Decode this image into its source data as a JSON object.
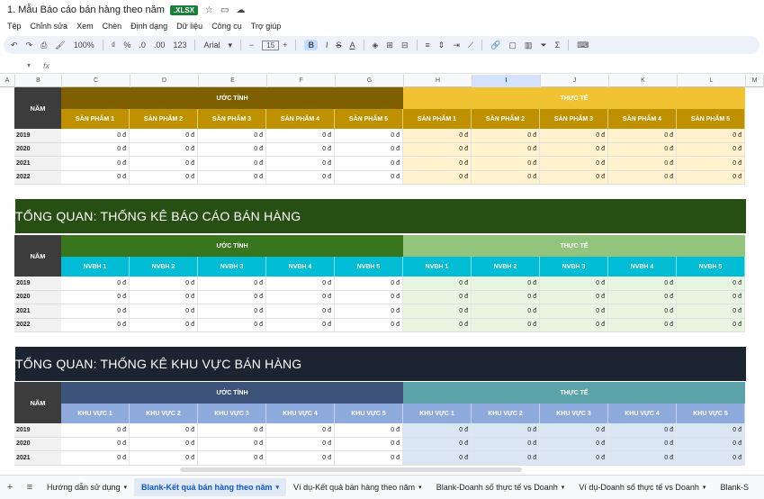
{
  "doc": {
    "title": "1. Mẫu Báo cáo bán hàng theo năm",
    "badge": ".XLSX"
  },
  "menu": [
    "Tệp",
    "Chỉnh sửa",
    "Xem",
    "Chèn",
    "Định dạng",
    "Dữ liệu",
    "Công cụ",
    "Trợ giúp"
  ],
  "toolbar": {
    "zoom": "100%",
    "font": "Arial",
    "font_size": "15",
    "num_format": "123",
    "percent": "%",
    "currency": "₫",
    "bold": "B",
    "italic": "I",
    "strike": "S",
    "text_color": "A",
    "dec_less": ".0",
    "dec_more": ".00",
    "minus": "−",
    "plus": "+"
  },
  "formula": {
    "fx": "fx",
    "namebox": "▾"
  },
  "columns": [
    "A",
    "B",
    "C",
    "D",
    "E",
    "F",
    "G",
    "H",
    "I",
    "J",
    "K",
    "L",
    "M"
  ],
  "selected_column": "I",
  "colors": {
    "estimate1": "#7f6000",
    "actual1": "#f1c232",
    "sub1": "#bf9000",
    "est_row": "#ffffff",
    "act_row": "#fff2cc",
    "nam": "#3c3c3c",
    "banner2": "#274e13",
    "estimate2": "#38761d",
    "actual2": "#93c47d",
    "sub2": "#00bcd4",
    "act_row2": "#e6f4e0",
    "banner3": "#1c2331",
    "estimate3": "#3d5278",
    "actual3": "#5ca3a9",
    "sub3": "#8ea9db",
    "act_row3": "#dbe6f5"
  },
  "table1": {
    "nam": "NĂM",
    "estimate": "ƯỚC TÍNH",
    "actual": "THỰC TẾ",
    "sub": [
      "SẢN PHẨM 1",
      "SẢN PHẨM 2",
      "SẢN PHẨM 3",
      "SẢN PHẨM 4",
      "SẢN PHẨM 5",
      "SẢN PHẨM 1",
      "SẢN PHẨM 2",
      "SẢN PHẨM 3",
      "SẢN PHẨM 4",
      "SẢN PHẨM 5"
    ],
    "years": [
      "2019",
      "2020",
      "2021",
      "2022"
    ]
  },
  "banner2": "TỔNG QUAN: THỐNG KÊ BÁO CÁO BÁN HÀNG",
  "table2": {
    "nam": "NĂM",
    "estimate": "ƯỚC TÍNH",
    "actual": "THỰC TẾ",
    "sub": [
      "NVBH 1",
      "NVBH 2",
      "NVBH 3",
      "NVBH 4",
      "NVBH 5",
      "NVBH 1",
      "NVBH 2",
      "NVBH 3",
      "NVBH 4",
      "NVBH 5"
    ],
    "years": [
      "2019",
      "2020",
      "2021",
      "2022"
    ]
  },
  "banner3": "TỔNG QUAN: THỐNG KÊ KHU VỰC BÁN HÀNG",
  "table3": {
    "nam": "NĂM",
    "estimate": "ƯỚC TÍNH",
    "actual": "THỰC TẾ",
    "sub": [
      "KHU VỰC 1",
      "KHU VỰC 2",
      "KHU VỰC 3",
      "KHU VỰC 4",
      "KHU VỰC 5",
      "KHU VỰC 1",
      "KHU VỰC 2",
      "KHU VỰC 3",
      "KHU VỰC 4",
      "KHU VỰC 5"
    ],
    "years": [
      "2019",
      "2020",
      "2021"
    ]
  },
  "cell_value": "0 đ",
  "sheets": [
    "Hướng dẫn sử dụng",
    "Blank-Kết quả bán hàng theo năm",
    "Ví dụ-Kết quả bán hàng theo năm",
    "Blank-Doanh số thực tế vs Doanh",
    "Ví dụ-Doanh số thực tế vs Doanh",
    "Blank-S"
  ],
  "active_sheet": 1
}
